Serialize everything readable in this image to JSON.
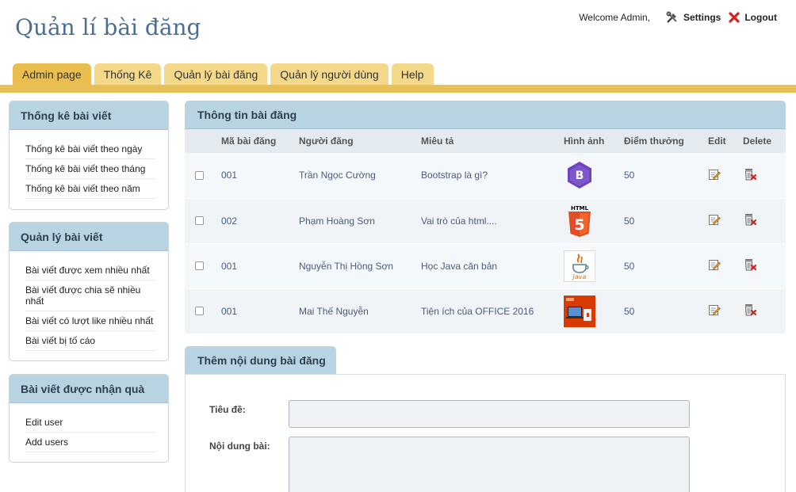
{
  "header": {
    "site_title": "Quản lí bài đăng",
    "welcome": "Welcome Admin,",
    "settings_label": "Settings",
    "logout_label": "Logout"
  },
  "nav": {
    "tabs": [
      {
        "label": "Admin page",
        "active": true
      },
      {
        "label": "Thống Kê"
      },
      {
        "label": "Quản lý bài đăng"
      },
      {
        "label": "Quản lý người dùng"
      },
      {
        "label": "Help"
      }
    ]
  },
  "sidebar": {
    "boxes": [
      {
        "title": "Thống kê bài viết",
        "items": [
          "Thống kê bài viết theo ngày",
          "Thống kê bài viết theo tháng",
          "Thống kê bài viết theo năm"
        ]
      },
      {
        "title": "Quản lý bài viết",
        "items": [
          "Bài viết được xem nhiều nhất",
          "Bài viết được chia sẽ nhiều nhất",
          "Bài viết có lượt like nhiều nhất",
          "Bài viết bị tố cáo"
        ]
      },
      {
        "title": "Bài viết được nhận quà",
        "items": [
          "Edit user",
          "Add users"
        ]
      }
    ]
  },
  "posts": {
    "title": "Thông tin bài đăng",
    "columns": [
      "Mã bài đăng",
      "Người đăng",
      "Miêu tả",
      "Hình ảnh",
      "Điểm thưởng",
      "Edit",
      "Delete"
    ],
    "rows": [
      {
        "id": "001",
        "author": "Trần Ngọc Cường",
        "desc": "Bootstrap là gì?",
        "image": "bootstrap-logo",
        "points": "50"
      },
      {
        "id": "002",
        "author": "Phạm Hoàng Sơn",
        "desc": "Vai trò của html....",
        "image": "html5-logo",
        "points": "50"
      },
      {
        "id": "001",
        "author": "Nguyễn Thị Hồng Sơn",
        "desc": "Học Java căn bản",
        "image": "java-logo",
        "points": "50"
      },
      {
        "id": "001",
        "author": "Mai Thế Nguyễn",
        "desc": "Tiện ích của OFFICE 2016",
        "image": "office-2016-image",
        "points": "50"
      }
    ],
    "java_logo_text": "Java",
    "html5_logo_text": "HTML",
    "html5_logo_number": "5",
    "bootstrap_logo_letter": "B"
  },
  "form": {
    "tab_label": "Thêm nội dung bài đăng",
    "title_label": "Tiêu đề:",
    "content_label": "Nội dung bài:",
    "title_value": "",
    "content_value": ""
  },
  "colors": {
    "tab_bg": "#f5d98a",
    "tab_active": "#e9bd4e",
    "panel_header": "#b8d4e3",
    "title_blue": "#4a6f93"
  }
}
